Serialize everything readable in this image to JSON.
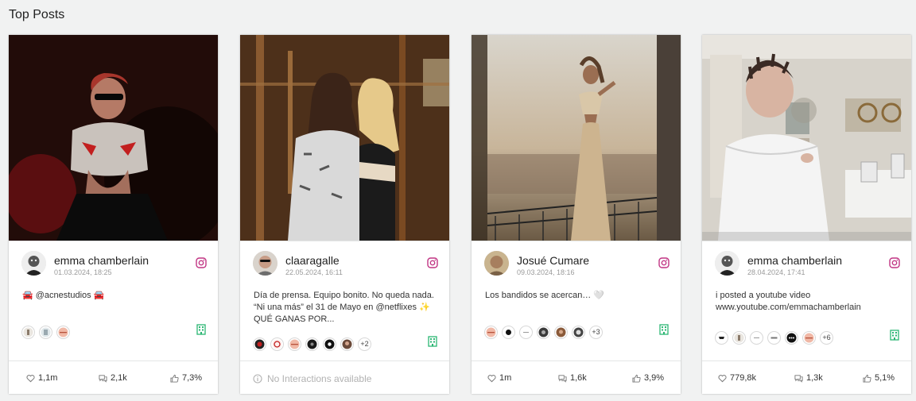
{
  "section_title": "Top Posts",
  "colors": {
    "instagram": "#c13584",
    "building_icon": "#2bb673",
    "background": "#f1f2f2"
  },
  "icons": {
    "platform": "instagram-icon",
    "brand": "building-icon",
    "likes": "heart-icon",
    "comments": "comment-icon",
    "engagement": "thumbs-up-icon",
    "info": "info-icon"
  },
  "posts": [
    {
      "author": "emma chamberlain",
      "date": "01.03.2024, 18:25",
      "caption": "🚘 @acnestudios 🚘",
      "extra_tags": "",
      "likes": "1,1m",
      "comments": "2,1k",
      "engagement": "7,3%"
    },
    {
      "author": "claaragalle",
      "date": "22.05.2024, 16:11",
      "caption": "Día de prensa. Equipo bonito. No queda nada. “Ni una más” el 31 de Mayo en @netflixes ✨ QUÉ GANAS POR...",
      "extra_tags": "+2",
      "no_interactions": "No Interactions available"
    },
    {
      "author": "Josué Cumare",
      "date": "09.03.2024, 18:16",
      "caption": "Los bandidos se acercan… 🤍",
      "extra_tags": "+3",
      "likes": "1m",
      "comments": "1,6k",
      "engagement": "3,9%"
    },
    {
      "author": "emma chamberlain",
      "date": "28.04.2024, 17:41",
      "caption": "i posted a youtube video www.youtube.com/emmachamberlain",
      "extra_tags": "+6",
      "likes": "779,8k",
      "comments": "1,3k",
      "engagement": "5,1%"
    }
  ]
}
